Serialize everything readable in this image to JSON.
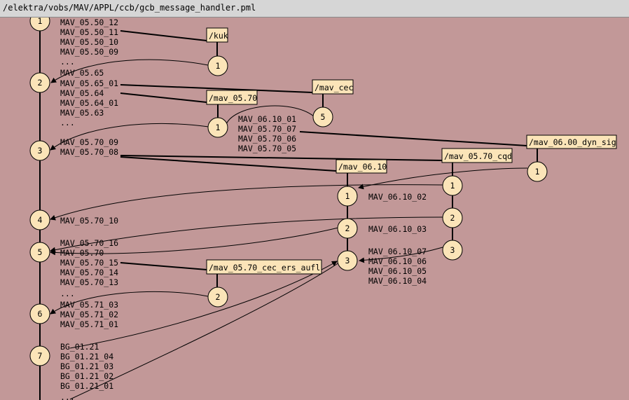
{
  "window": {
    "title": "/elektra/vobs/MAV/APPL/ccb/gcb_message_handler.pml"
  },
  "main_nodes": [
    "1",
    "2",
    "3",
    "4",
    "5",
    "6",
    "7"
  ],
  "main_labels": [
    "MAV_05.50_12",
    "MAV_05.50_11",
    "MAV_05.50_10",
    "MAV_05.50_09",
    "...",
    "MAV_05.65",
    "MAV_05.65_01",
    "MAV_05.64",
    "MAV_05.64_01",
    "MAV_05.63",
    "...",
    "MAV_05.70_09",
    "MAV_05.70_08",
    "MAV_05.70_10",
    "MAV_05.70_16",
    "MAV_05.70",
    "MAV_05.70_15",
    "MAV_05.70_14",
    "MAV_05.70_13",
    "...",
    "MAV_05.71_03",
    "MAV_05.71_02",
    "MAV_05.71_01",
    "BG_01.21",
    "BG_01.21_04",
    "BG_01.21_03",
    "BG_01.21_02",
    "BG_01.21_01",
    "..."
  ],
  "branches": {
    "kuk": {
      "name": "/kuk",
      "nodes": [
        "1"
      ]
    },
    "mav_cec": {
      "name": "/mav_cec",
      "nodes": [
        "5"
      ]
    },
    "mav_05_70": {
      "name": "/mav_05.70",
      "nodes": [
        "1"
      ],
      "labels": [
        "MAV_06.10_01",
        "MAV_05.70_07",
        "MAV_05.70_06",
        "MAV_05.70_05"
      ]
    },
    "mav_06_00_dyn_sig": {
      "name": "/mav_06.00_dyn_sig",
      "nodes": [
        "1"
      ]
    },
    "mav_05_70_cqd": {
      "name": "/mav_05.70_cqd",
      "nodes": [
        "1",
        "2",
        "3"
      ]
    },
    "mav_06_10": {
      "name": "/mav_06.10",
      "nodes": [
        "1",
        "2",
        "3"
      ],
      "labels": [
        "MAV_06.10_02",
        "MAV_06.10_03",
        "MAV_06.10_07",
        "MAV_06.10_06",
        "MAV_06.10_05",
        "MAV_06.10_04"
      ]
    },
    "mav_05_70_cec_ers_aufl": {
      "name": "/mav_05.70_cec_ers_aufl",
      "nodes": [
        "2"
      ]
    }
  }
}
